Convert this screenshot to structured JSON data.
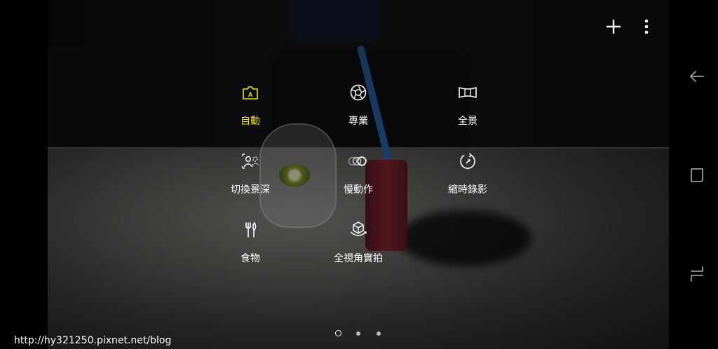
{
  "modes": [
    {
      "label": "自動",
      "icon": "auto-camera-icon",
      "active": true
    },
    {
      "label": "專業",
      "icon": "aperture-icon",
      "active": false
    },
    {
      "label": "全景",
      "icon": "panorama-icon",
      "active": false
    },
    {
      "label": "切換景深",
      "icon": "selective-focus-icon",
      "active": false
    },
    {
      "label": "慢動作",
      "icon": "slow-motion-icon",
      "active": false
    },
    {
      "label": "縮時錄影",
      "icon": "hyperlapse-icon",
      "active": false
    },
    {
      "label": "食物",
      "icon": "food-icon",
      "active": false
    },
    {
      "label": "全視角實拍",
      "icon": "virtual-shot-icon",
      "active": false
    }
  ],
  "auto_icon_letter": "A",
  "top_actions": [
    "add-icon",
    "more-options-icon"
  ],
  "navigation": [
    "back-icon",
    "home-icon",
    "recents-icon"
  ],
  "pager": {
    "pages": 3,
    "current": 1
  },
  "watermark": "http://hy321250.pixnet.net/blog",
  "colors": {
    "active": "#f2e600",
    "text": "#ffffff"
  }
}
